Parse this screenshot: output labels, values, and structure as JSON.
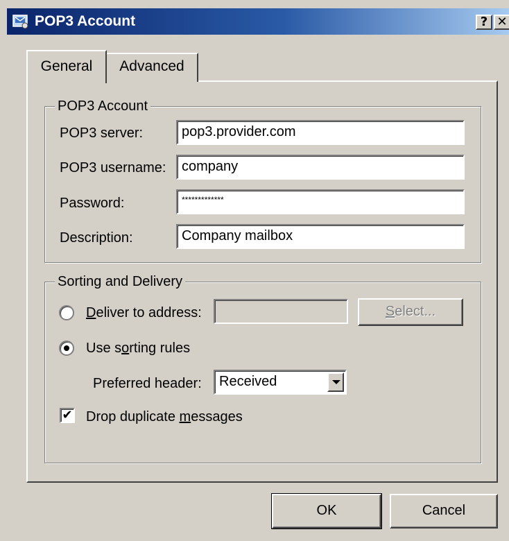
{
  "window": {
    "title": "POP3 Account",
    "help_glyph": "?",
    "close_glyph": "✕",
    "icon": "mail-account-icon"
  },
  "tabs": [
    {
      "label": "General",
      "active": true
    },
    {
      "label": "Advanced",
      "active": false
    }
  ],
  "pop3_account": {
    "legend": "POP3 Account",
    "server_label": "POP3 server:",
    "server_value": "pop3.provider.com",
    "username_label": "POP3 username:",
    "username_value": "company",
    "password_label": "Password:",
    "password_value": "*************",
    "description_label": "Description:",
    "description_value": "Company mailbox"
  },
  "sorting": {
    "legend": "Sorting and Delivery",
    "deliver_label_prefix": "D",
    "deliver_label_rest": "eliver to address:",
    "deliver_value": "",
    "select_button_prefix": "S",
    "select_button_rest": "elect...",
    "use_rules_label_a": "Use s",
    "use_rules_label_o": "o",
    "use_rules_label_b": "rting rules",
    "preferred_header_label": "Preferred header:",
    "preferred_header_value": "Received",
    "drop_dup_label_a": "Drop duplicate ",
    "drop_dup_label_m": "m",
    "drop_dup_label_b": "essages",
    "drop_dup_checked": true,
    "delivery_mode": "sorting-rules"
  },
  "buttons": {
    "ok": "OK",
    "cancel": "Cancel"
  },
  "colors": {
    "face": "#d4d0c8",
    "title_start": "#0a246a",
    "title_end": "#a6caf0"
  }
}
